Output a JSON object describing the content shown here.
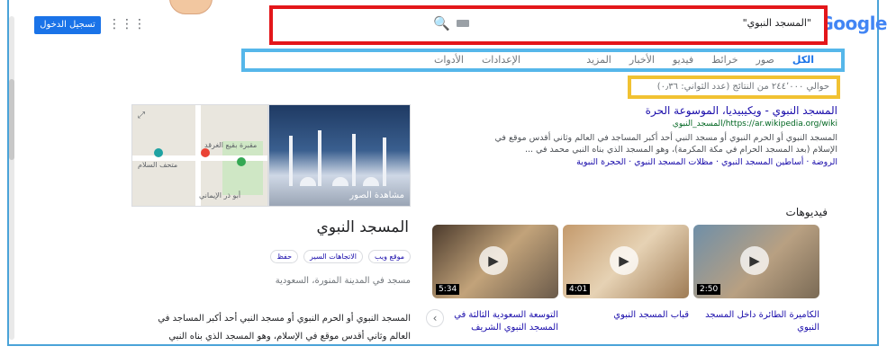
{
  "header": {
    "signin_label": "تسجيل الدخول",
    "apps_icon": "grid-icon",
    "logo": "Google"
  },
  "search": {
    "query": "\"المسجد النبوي\"",
    "search_icon": "search-icon",
    "keyboard_icon": "keyboard-icon"
  },
  "tabs": {
    "items": [
      "الكل",
      "صور",
      "خرائط",
      "فيديو",
      "الأخبار",
      "المزيد"
    ],
    "settings": "الإعدادات",
    "tools": "الأدوات"
  },
  "results": {
    "count_text": "حوالي ٢٤٤٬٠٠٠ من النتائج (عدد الثواني: ٠٫٣٦)",
    "first": {
      "title": "المسجد النبوي - ويكيبيديا، الموسوعة الحرة",
      "url": "https://ar.wikipedia.org/wiki/المسجد_النبوي",
      "snippet1": "المسجد النبوي أو الحرم النبوي أو مسجد النبي أحد أكبر المساجد في العالم وثاني أقدس موقع في",
      "snippet2": "الإسلام (بعد المسجد الحرام في مكة المكرمة)، وهو المسجد الذي بناه النبي محمد في ...",
      "links": "الروضة · أساطين المسجد النبوي · مظلات المسجد النبوي · الحجرة النبوية"
    }
  },
  "videos": {
    "title": "فيديوهات",
    "items": [
      {
        "title": "الكاميرة الطائرة داخل المسجد النبوي",
        "duration": "2:50"
      },
      {
        "title": "قباب المسجد النبوي",
        "duration": "4:01"
      },
      {
        "title": "التوسعة السعودية الثالثة في المسجد النبوي الشريف",
        "duration": "5:34"
      }
    ]
  },
  "knowledge_panel": {
    "photo_label": "مشاهدة الصور",
    "map_labels": {
      "a": "مقبرة بقيع الغرقد",
      "b": "متحف السلام",
      "c": "أبو ذر الإيماني"
    },
    "title": "المسجد النبوي",
    "buttons": [
      "موقع ويب",
      "الاتجاهات السير",
      "حفظ"
    ],
    "subtitle": "مسجد في المدينة المنورة، السعودية",
    "desc1": "المسجد النبوي أو الحرم النبوي أو مسجد النبي أحد أكبر المساجد في",
    "desc2": "العالم وثاني أقدس موقع في الإسلام، وهو المسجد الذي بناه النبي"
  },
  "colors": {
    "search_outline": "#e3161a",
    "tabs_outline": "#56b7ea",
    "count_outline": "#f1c232",
    "link_blue": "#1a0dab"
  }
}
